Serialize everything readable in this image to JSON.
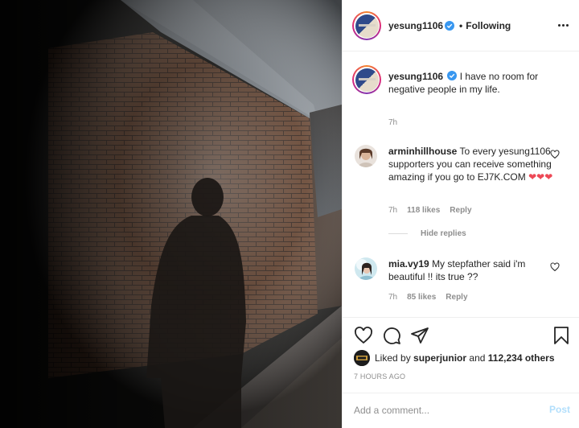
{
  "post_author": {
    "username": "yesung1106",
    "verified": true,
    "follow_status": "Following",
    "menu_icon": "more-horizontal-icon"
  },
  "caption": {
    "username": "yesung1106",
    "text": "I have no room for negative people in my life.",
    "time": "7h"
  },
  "comments": [
    {
      "username": "arminhillhouse",
      "text": "To every yesung1106 supporters you can receive something amazing if you go to EJ7K.COM",
      "emoji": "❤❤❤",
      "time": "7h",
      "likes": "118 likes",
      "reply_label": "Reply"
    },
    {
      "username": "mia.vy19",
      "text": "My stepfather said i'm beautiful !! its true ??",
      "time": "7h",
      "likes": "85 likes",
      "reply_label": "Reply"
    }
  ],
  "hide_replies_label": "Hide replies",
  "actions": {
    "like_icon": "heart-icon",
    "comment_icon": "comment-icon",
    "share_icon": "send-icon",
    "save_icon": "bookmark-icon"
  },
  "likes_summary": {
    "prefix": "Liked by",
    "user": "superjunior",
    "joiner": "and",
    "others": "112,234 others"
  },
  "timestamp": "7 HOURS AGO",
  "comment_form": {
    "placeholder": "Add a comment...",
    "post_label": "Post"
  },
  "colors": {
    "verified_blue": "#3897f0",
    "heart_red": "#ed4956",
    "post_disabled": "#b2dffc"
  }
}
